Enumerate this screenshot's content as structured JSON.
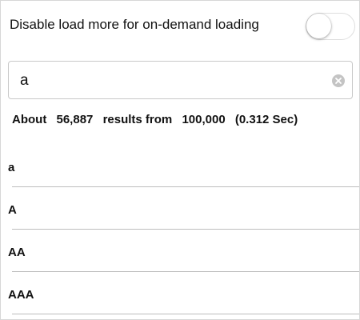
{
  "settings": {
    "disable_load_more_label": "Disable load more for on-demand loading",
    "disable_load_more_enabled": false
  },
  "search": {
    "value": "a",
    "clear_icon": "clear-circle-icon"
  },
  "results_info": {
    "prefix": "About",
    "count": "56,887",
    "middle": "results from",
    "total": "100,000",
    "time": "(0.312 Sec)"
  },
  "results": [
    {
      "label": "a"
    },
    {
      "label": "A"
    },
    {
      "label": "AA"
    },
    {
      "label": "AAA"
    }
  ],
  "colors": {
    "background": "#ffffff",
    "border": "#c9c9c9",
    "divider": "#bdbdbd",
    "clear_icon": "#c4c4c4"
  }
}
